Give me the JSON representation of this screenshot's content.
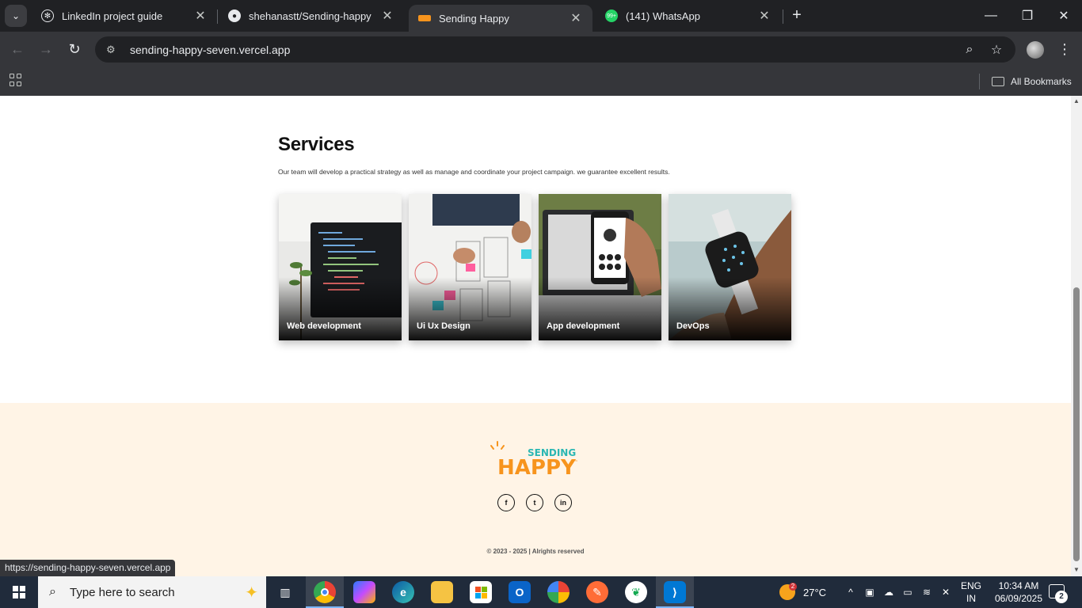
{
  "browser": {
    "tabs": [
      {
        "title": "LinkedIn project guide",
        "icon": "chatgpt-icon"
      },
      {
        "title": "shehanastt/Sending-happy",
        "icon": "github-icon"
      },
      {
        "title": "Sending Happy",
        "icon": "site-favicon",
        "active": true
      },
      {
        "title": "(141) WhatsApp",
        "icon": "whatsapp-icon"
      }
    ],
    "url": "sending-happy-seven.vercel.app",
    "all_bookmarks": "All Bookmarks",
    "status_url": "https://sending-happy-seven.vercel.app"
  },
  "services": {
    "title": "Services",
    "description": "Our team will develop a practical strategy as well as manage and coordinate your project campaign. we guarantee excellent results.",
    "cards": [
      {
        "label": "Web development"
      },
      {
        "label": "Ui Ux Design"
      },
      {
        "label": "App development"
      },
      {
        "label": "DevOps"
      }
    ]
  },
  "footer": {
    "logo_top": "SENDING",
    "logo_bottom": "HAPPY",
    "logo_tm": "™",
    "social": [
      {
        "label": "f",
        "icon": "facebook-icon"
      },
      {
        "label": "t",
        "icon": "twitter-icon"
      },
      {
        "label": "in",
        "icon": "linkedin-icon"
      }
    ],
    "copyright": "© 2023 - 2025 | Alrights reserved"
  },
  "taskbar": {
    "search_placeholder": "Type here to search",
    "weather": "27°C",
    "weather_badge": "2",
    "lang_line1": "ENG",
    "lang_line2": "IN",
    "time": "10:34 AM",
    "date": "06/09/2025",
    "notifications": "2"
  },
  "colors": {
    "chrome_dark": "#202124",
    "chrome_toolbar": "#35363a",
    "footer_bg": "#fff4e6",
    "logo_orange": "#f7941d",
    "logo_teal": "#2bb7b3"
  }
}
